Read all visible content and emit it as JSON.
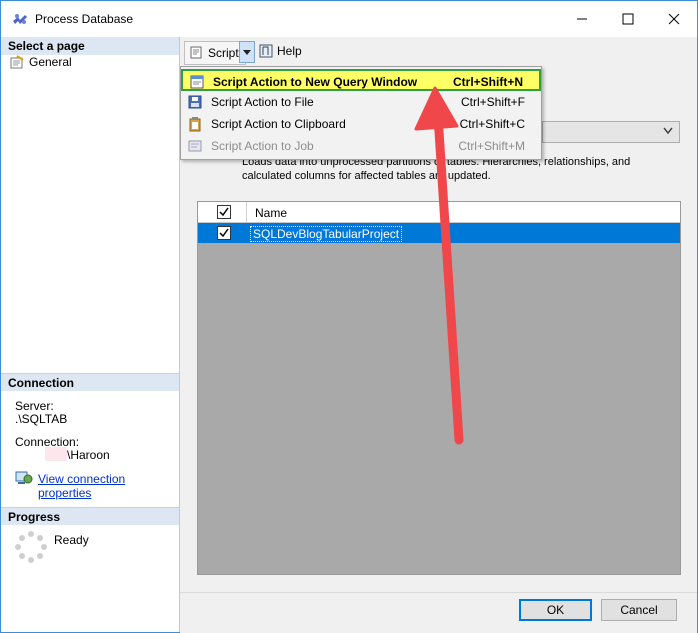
{
  "window": {
    "title": "Process Database"
  },
  "left_panel": {
    "select_page_header": "Select a page",
    "pages": [
      {
        "label": "General"
      }
    ],
    "connection_header": "Connection",
    "server_label": "Server:",
    "server_value": ".\\SQLTAB",
    "connection_label": "Connection:",
    "connection_value": "\\Haroon",
    "view_connection_link": "View connection properties",
    "progress_header": "Progress",
    "progress_status": "Ready"
  },
  "toolbar": {
    "script_label": "Script",
    "help_label": "Help"
  },
  "script_menu": {
    "items": [
      {
        "label": "Script Action to New Query Window",
        "shortcut": "Ctrl+Shift+N",
        "icon": "query-window-icon",
        "state": "highlighted"
      },
      {
        "label": "Script Action to File",
        "shortcut": "Ctrl+Shift+F",
        "icon": "save-icon",
        "state": "enabled"
      },
      {
        "label": "Script Action to Clipboard",
        "shortcut": "Ctrl+Shift+C",
        "icon": "clipboard-icon",
        "state": "enabled"
      },
      {
        "label": "Script Action to Job",
        "shortcut": "Ctrl+Shift+M",
        "icon": "job-icon",
        "state": "disabled"
      }
    ]
  },
  "main": {
    "description": "Loads data into unprocessed partitions or tables. Hierarchies, relationships, and calculated columns for affected tables are updated.",
    "grid": {
      "header_name": "Name",
      "header_checked": true,
      "rows": [
        {
          "name": "SQLDevBlogTabularProject",
          "checked": true,
          "selected": true
        }
      ]
    }
  },
  "buttons": {
    "ok": "OK",
    "cancel": "Cancel"
  },
  "colors": {
    "selection": "#0078d7",
    "highlight": "#ffff66",
    "highlight_border": "#2ea043",
    "arrow": "#f0474b",
    "link": "#0033cc"
  }
}
